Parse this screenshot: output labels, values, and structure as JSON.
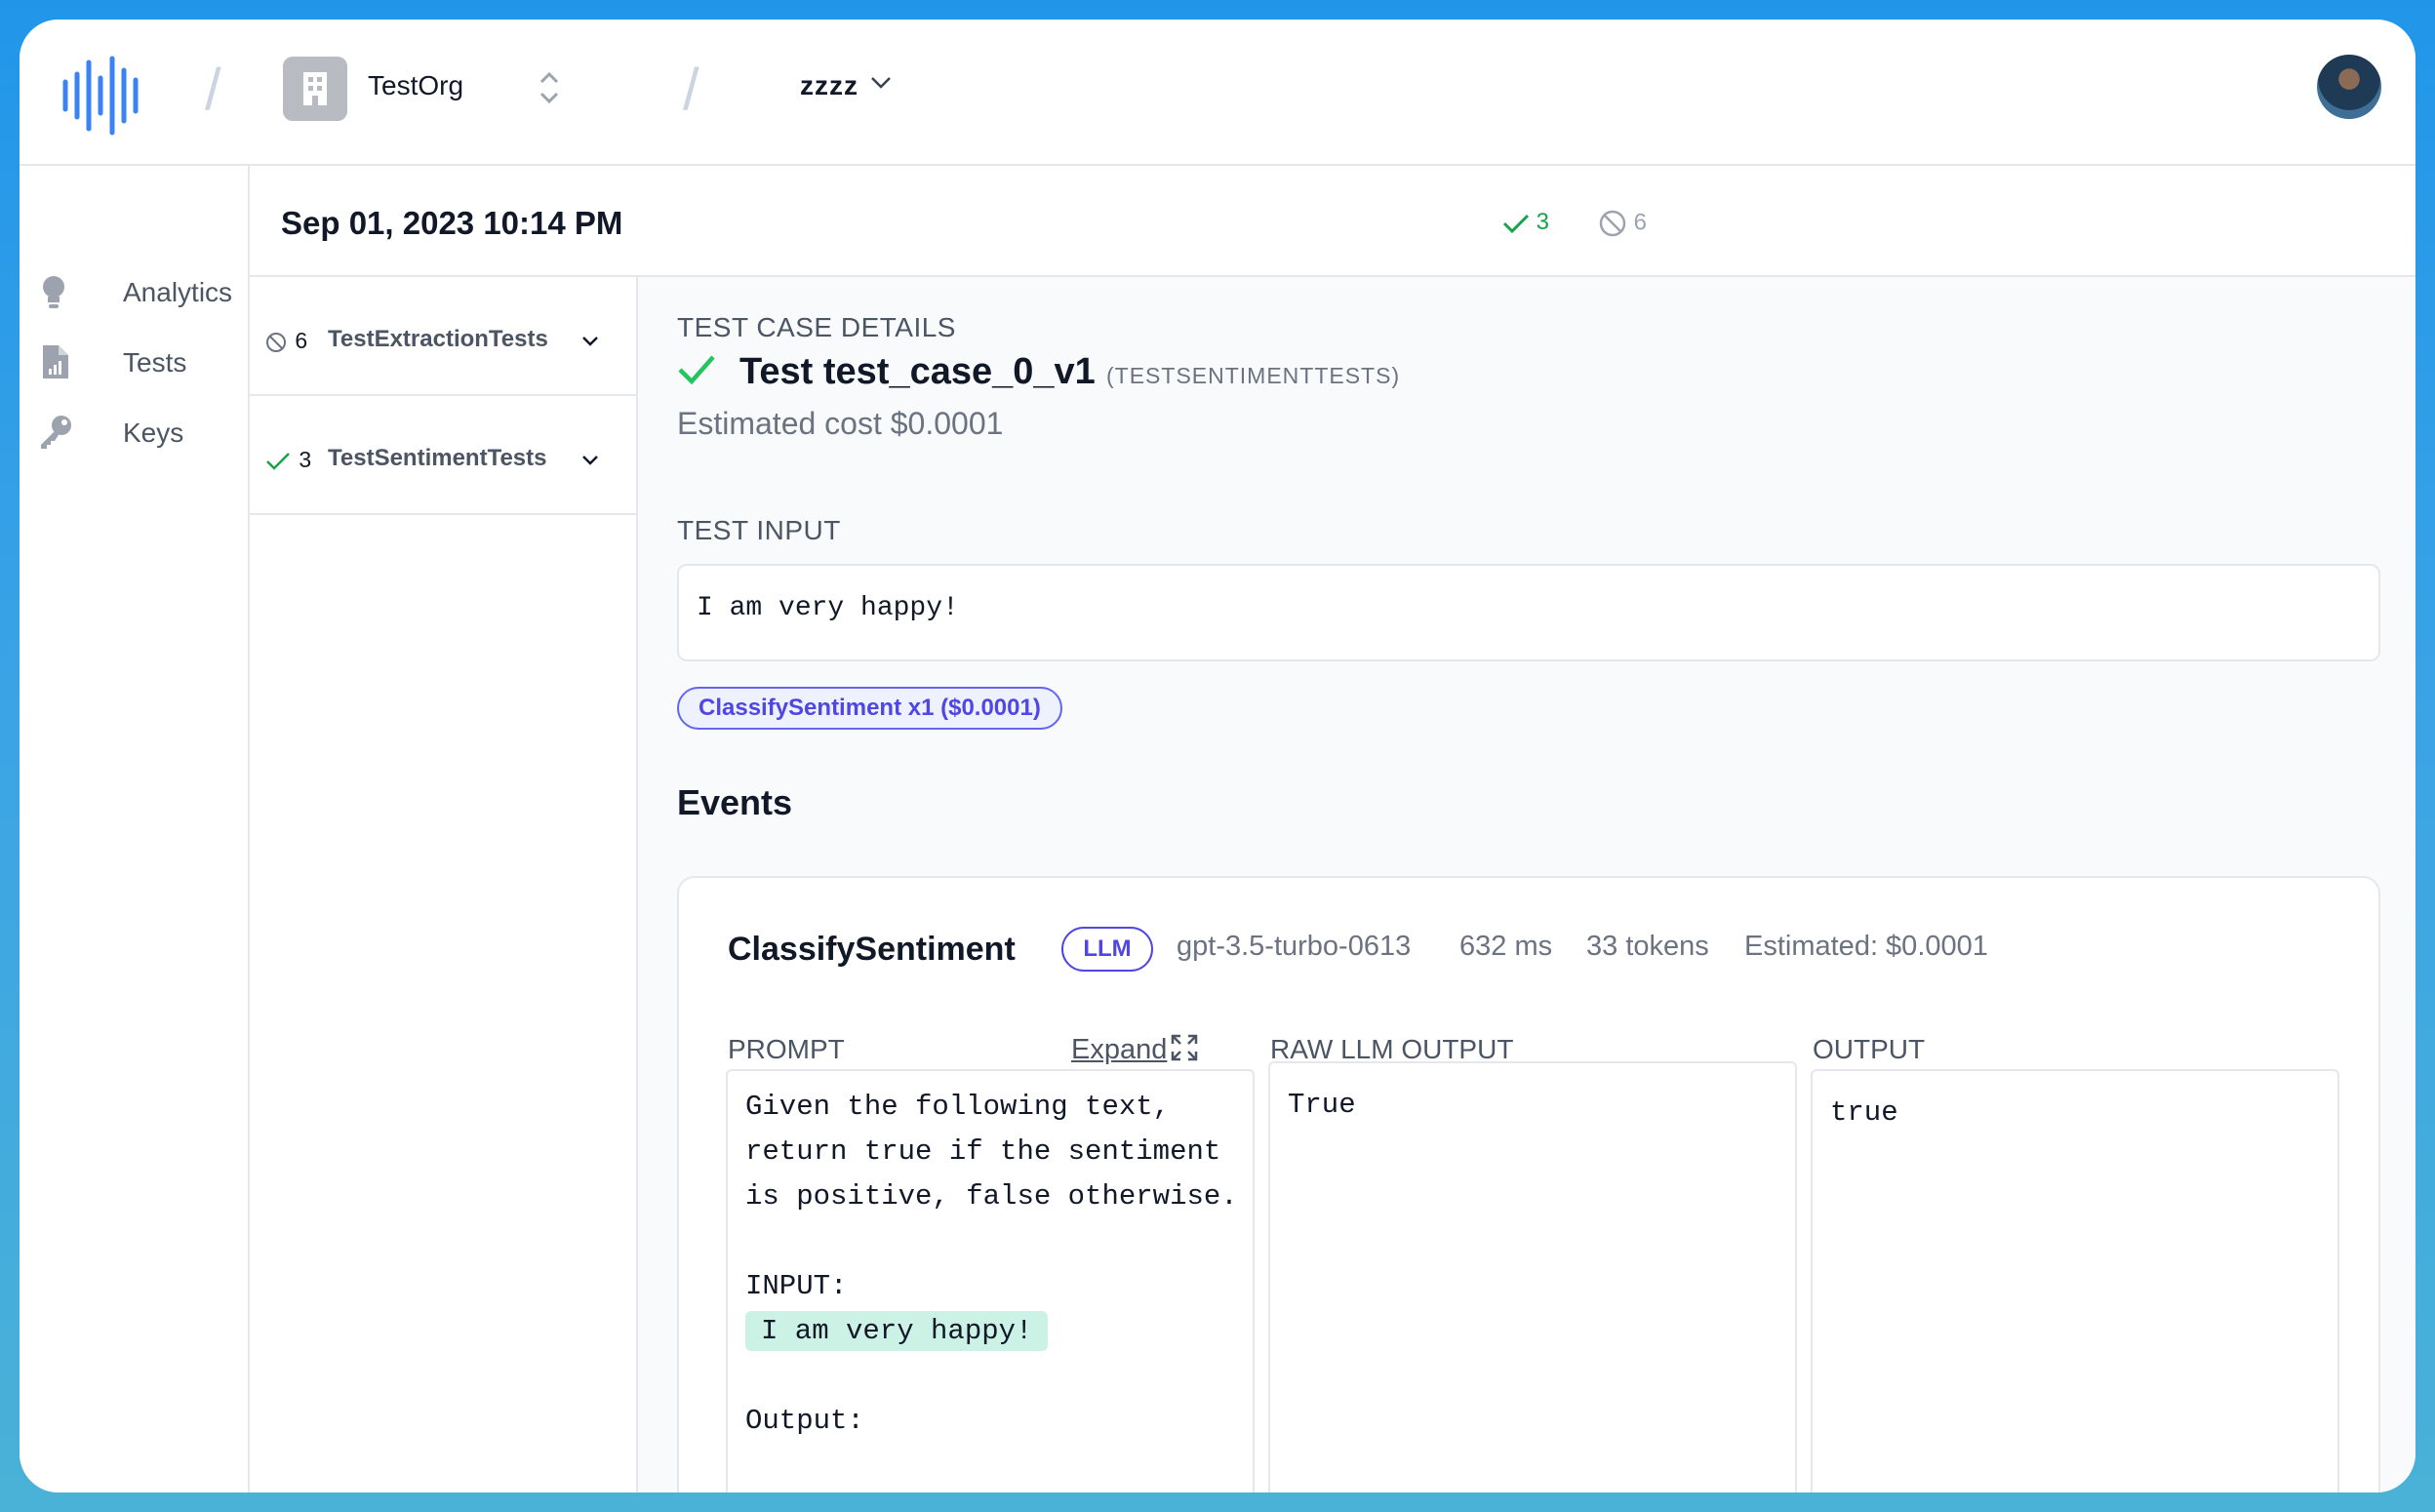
{
  "topbar": {
    "org_name": "TestOrg",
    "project_name": "zzzz"
  },
  "sidebar": {
    "items": [
      {
        "label": "Analytics",
        "icon": "lightbulb-icon"
      },
      {
        "label": "Tests",
        "icon": "file-chart-icon"
      },
      {
        "label": "Keys",
        "icon": "key-icon"
      }
    ]
  },
  "run": {
    "date": "Sep 01, 2023 10:14 PM",
    "passed": "3",
    "skipped": "6"
  },
  "suites": [
    {
      "count": "6",
      "name": "TestExtractionTests",
      "status": "skipped"
    },
    {
      "count": "3",
      "name": "TestSentimentTests",
      "status": "passed"
    }
  ],
  "test_case": {
    "section_label": "TEST CASE DETAILS",
    "title": "Test test_case_0_v1",
    "suite": "(TESTSENTIMENTTESTS)",
    "cost": "Estimated cost $0.0001",
    "input_label": "TEST INPUT",
    "input_value": "I am very happy!",
    "chip": "ClassifySentiment x1 ($0.0001)"
  },
  "events": {
    "title": "Events",
    "items": [
      {
        "name": "ClassifySentiment",
        "badge": "LLM",
        "model": "gpt-3.5-turbo-0613",
        "latency": "632 ms",
        "tokens": "33 tokens",
        "estimated": "Estimated: $0.0001",
        "prompt_label": "PROMPT",
        "expand_label": "Expand",
        "raw_label": "RAW LLM OUTPUT",
        "output_label": "OUTPUT",
        "prompt_lines": [
          "Given the following text,",
          "return true if the sentiment",
          "is positive, false otherwise.",
          "",
          "INPUT:"
        ],
        "prompt_input": "I am very happy!",
        "prompt_tail": "Output:",
        "raw_output": "True",
        "output": "true"
      }
    ]
  },
  "colors": {
    "accent": "#4f46e5",
    "pass": "#16a34a",
    "skip": "#9ca3af",
    "highlight": "#ccf2e6",
    "logo": "#3b82f6"
  }
}
